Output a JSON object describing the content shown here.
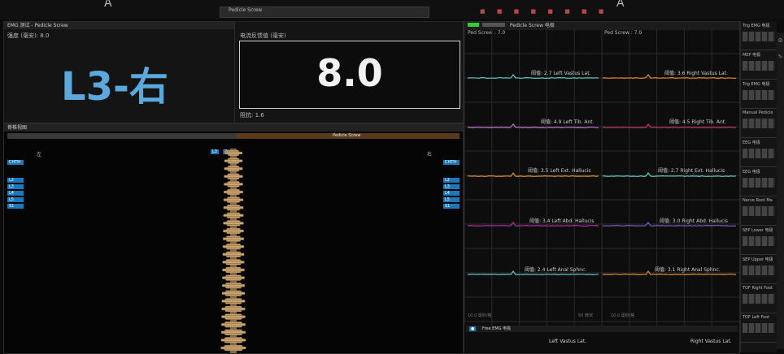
{
  "topbar": {
    "tab_left": "A",
    "tab_right": "A",
    "center_tab": "Pedicle Screw"
  },
  "emg_panel": {
    "title": "EMG 测试 - Pedicle Screw",
    "level_label": "强度 (毫安): 8.0",
    "big_level": "L3-右"
  },
  "stim_panel": {
    "title": "电流反馈值 (毫安)",
    "value": "8.0",
    "footer": "阻抗: 1.6"
  },
  "spine_panel": {
    "title": "脊椎视图",
    "subtitle": "Pedicle Screw",
    "tabs": [
      "L3",
      "Pedi"
    ],
    "left_side": "左",
    "right_side": "右",
    "left_btn_header": "CHTH",
    "right_btn_header": "CHTH",
    "levels": [
      "L2",
      "L3",
      "L4",
      "L5",
      "S1"
    ]
  },
  "trace_panel": {
    "title": "Pedicle Screw 电极",
    "left_head": "Ped Screw : 7.0",
    "right_head": "Ped Screw : 7.0",
    "left_labels": [
      "阈值: 2.7 Left Vastus Lat.",
      "阈值: 4.9 Left Tib. Ant.",
      "阈值: 3.5 Left Ext. Hallucis",
      "阈值: 3.4 Left Abd. Hallucis",
      "阈值: 2.4 Left Anal Sphnc."
    ],
    "right_labels": [
      "阈值: 3.6 Right Vastus Lat.",
      "阈值: 4.5 Right Tib. Ant.",
      "阈值: 2.7 Right Ext. Hallucis",
      "阈值: 3.0 Right Abd. Hallucis",
      "阈值: 3.1 Right Anal Sphnc."
    ],
    "colors_left": [
      "#5fc7c0",
      "#c070d0",
      "#e08a2c",
      "#b030a0",
      "#5fc7c0"
    ],
    "colors_right": [
      "#e08a2c",
      "#c0306a",
      "#5fc7c0",
      "#7a5cc8",
      "#e08a2c"
    ],
    "footer_left": "10.0 毫秒/格",
    "footer_mid": "50 微伏",
    "footer_right": "10.0 毫秒/格",
    "free_title": "Free EMG 电极",
    "free_left": "Left Vastus Lat.",
    "free_right": "Right Vastus Lat."
  },
  "right_panel": {
    "items": [
      "Trig EMG 电极",
      "MEP 电极",
      "Trig EMG 电极",
      "Manual Pedicle",
      "EEG 电极",
      "EEG 电极",
      "Nerve Root Ma",
      "SEP Lower 电极",
      "SEP Upper 电极",
      "TOF Right Foot",
      "TOF Left Foot"
    ]
  }
}
